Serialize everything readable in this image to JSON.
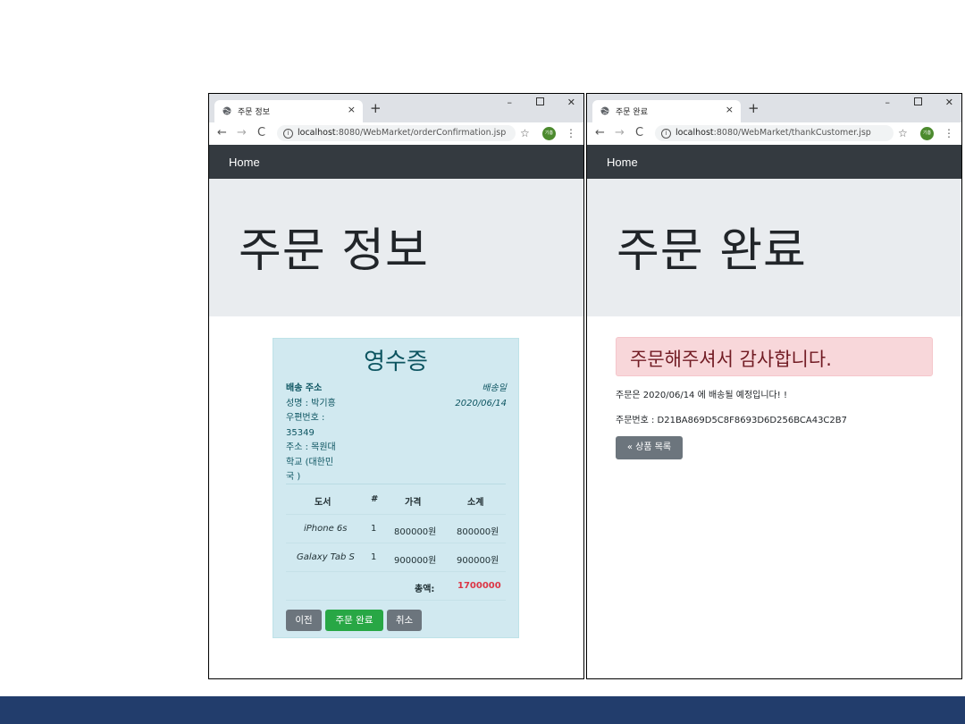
{
  "windows": [
    {
      "tab_title": "주문 정보",
      "url_host": "localhost",
      "url_path": ":8080/WebMarket/orderConfirmation.jsp",
      "profile_label": "기흥",
      "nav_home": "Home",
      "jumbotron_title": "주문 정보"
    },
    {
      "tab_title": "주문 완료",
      "url_host": "localhost",
      "url_path": ":8080/WebMarket/thankCustomer.jsp",
      "profile_label": "기흥",
      "nav_home": "Home",
      "jumbotron_title": "주문 완료"
    }
  ],
  "icons": {
    "globe": "globe-icon",
    "close": "×",
    "new_tab": "+",
    "minimize": "–",
    "window_close": "✕",
    "back": "←",
    "forward": "→",
    "reload": "C",
    "info": "i",
    "star": "☆",
    "menu": "⋮"
  },
  "receipt": {
    "title": "영수증",
    "address_head": "배송 주소",
    "address_lines": [
      "성명 : 박기흥",
      "우편번호 :",
      "35349",
      "주소 : 목원대",
      "학교 (대한민",
      "국 )"
    ],
    "ship_label": "배송일",
    "ship_date": "2020/06/14",
    "table_headers": [
      "도서",
      "#",
      "가격",
      "소계"
    ],
    "rows": [
      [
        "iPhone 6s",
        "1",
        "800000원",
        "800000원"
      ],
      [
        "Galaxy Tab S",
        "1",
        "900000원",
        "900000원"
      ]
    ],
    "total_label": "총액:",
    "total_value": "1700000",
    "buttons": {
      "prev": "이전",
      "complete": "주문 완료",
      "cancel": "취소"
    }
  },
  "thanks": {
    "alert": "주문해주셔서 감사합니다.",
    "ship_notice": "주문은 2020/06/14 에 배송될 예정입니다! !",
    "order_no": "주문번호 : D21BA869D5C8F8693D6D256BCA43C2B7",
    "list_button": "« 상품 목록"
  },
  "colors": {
    "navbar": "#343a40",
    "jumbotron": "#e9ecef",
    "receipt_bg": "#d1e9f0",
    "alert_bg": "#f8d7da",
    "btn_gray": "#6c757d",
    "btn_green": "#28a745",
    "total_red": "#dc3545",
    "slide_bar": "#223d6c"
  }
}
